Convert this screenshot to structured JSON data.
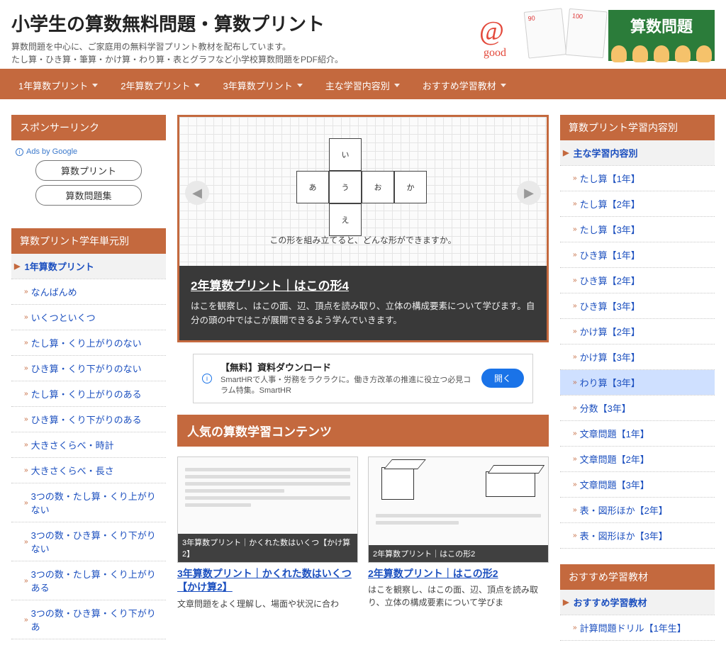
{
  "header": {
    "title": "小学生の算数無料問題・算数プリント",
    "desc_line1": "算数問題を中心に、ご家庭用の無料学習プリント教材を配布しています。",
    "desc_line2": "たし算・ひき算・筆算・かけ算・わり算・表とグラフなど小学校算数問題をPDF紹介。",
    "board_label": "算数問題",
    "paper1": "90",
    "paper2": "100"
  },
  "nav": [
    "1年算数プリント",
    "2年算数プリント",
    "3年算数プリント",
    "主な学習内容別",
    "おすすめ学習教材"
  ],
  "left": {
    "sponsor_title": "スポンサーリンク",
    "ads_label": "Ads by Google",
    "ad_buttons": [
      "算数プリント",
      "算数問題集"
    ],
    "units_title": "算数プリント学年単元別",
    "units_top": "1年算数プリント",
    "units": [
      "なんばんめ",
      "いくつといくつ",
      "たし算・くり上がりのない",
      "ひき算・くり下がりのない",
      "たし算・くり上がりのある",
      "ひき算・くり下がりのある",
      "大きさくらべ・時計",
      "大きさくらべ・長さ",
      "3つの数・たし算・くり上がりない",
      "3つの数・ひき算・くり下がりない",
      "3つの数・たし算・くり上がりある",
      "3つの数・ひき算・くり下がりあ"
    ]
  },
  "slider": {
    "caption": "この形を組み立てると、どんな形ができますか。",
    "title": "2年算数プリント｜はこの形4",
    "body": "はこを観察し、はこの面、辺、頂点を読み取り、立体の構成要素について学びます。自分の頭の中ではこが展開できるよう学んでいきます。",
    "faces": [
      "い",
      "あ",
      "う",
      "お",
      "か",
      "え"
    ]
  },
  "inline_ad": {
    "title": "【無料】資料ダウンロード",
    "body": "SmartHRで人事・労務をラクラクに。働き方改革の推進に役立つ必見コラム特集。SmartHR",
    "cta": "開く"
  },
  "popular": {
    "title": "人気の算数学習コンテンツ",
    "cards": [
      {
        "thumb_label": "3年算数プリント｜かくれた数はいくつ【かけ算2】",
        "link": "3年算数プリント｜かくれた数はいくつ【かけ算2】",
        "excerpt": "文章問題をよく理解し、場面や状況に合わ"
      },
      {
        "thumb_label": "2年算数プリント｜はこの形2",
        "link": "2年算数プリント｜はこの形2",
        "excerpt": "はこを観察し、はこの面、辺、頂点を読み取り、立体の構成要素について学びま"
      }
    ]
  },
  "right": {
    "cat_title": "算数プリント学習内容別",
    "cat_top": "主な学習内容別",
    "cats": [
      "たし算【1年】",
      "たし算【2年】",
      "たし算【3年】",
      "ひき算【1年】",
      "ひき算【2年】",
      "ひき算【3年】",
      "かけ算【2年】",
      "かけ算【3年】",
      "わり算【3年】",
      "分数【3年】",
      "文章問題【1年】",
      "文章問題【2年】",
      "文章問題【3年】",
      "表・図形ほか【2年】",
      "表・図形ほか【3年】"
    ],
    "highlight_index": 8,
    "rec_title": "おすすめ学習教材",
    "rec_top": "おすすめ学習教材",
    "recs": [
      "計算問題ドリル【1年生】"
    ]
  }
}
